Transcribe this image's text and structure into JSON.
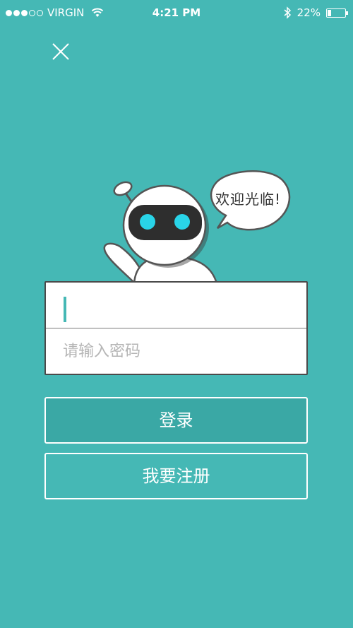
{
  "status_bar": {
    "carrier": "VIRGIN",
    "time": "4:21 PM",
    "battery": "22%",
    "signal_bars": 3
  },
  "close_icon": "close-icon",
  "mascot": {
    "speech_bubble": "欢迎光临!"
  },
  "form": {
    "username_placeholder": "",
    "password_placeholder": "请输入密码"
  },
  "buttons": {
    "login": "登录",
    "register": "我要注册"
  },
  "colors": {
    "background": "#45b8b5",
    "login_button": "#3aa8a5",
    "robot_eye": "#29d4e8"
  }
}
